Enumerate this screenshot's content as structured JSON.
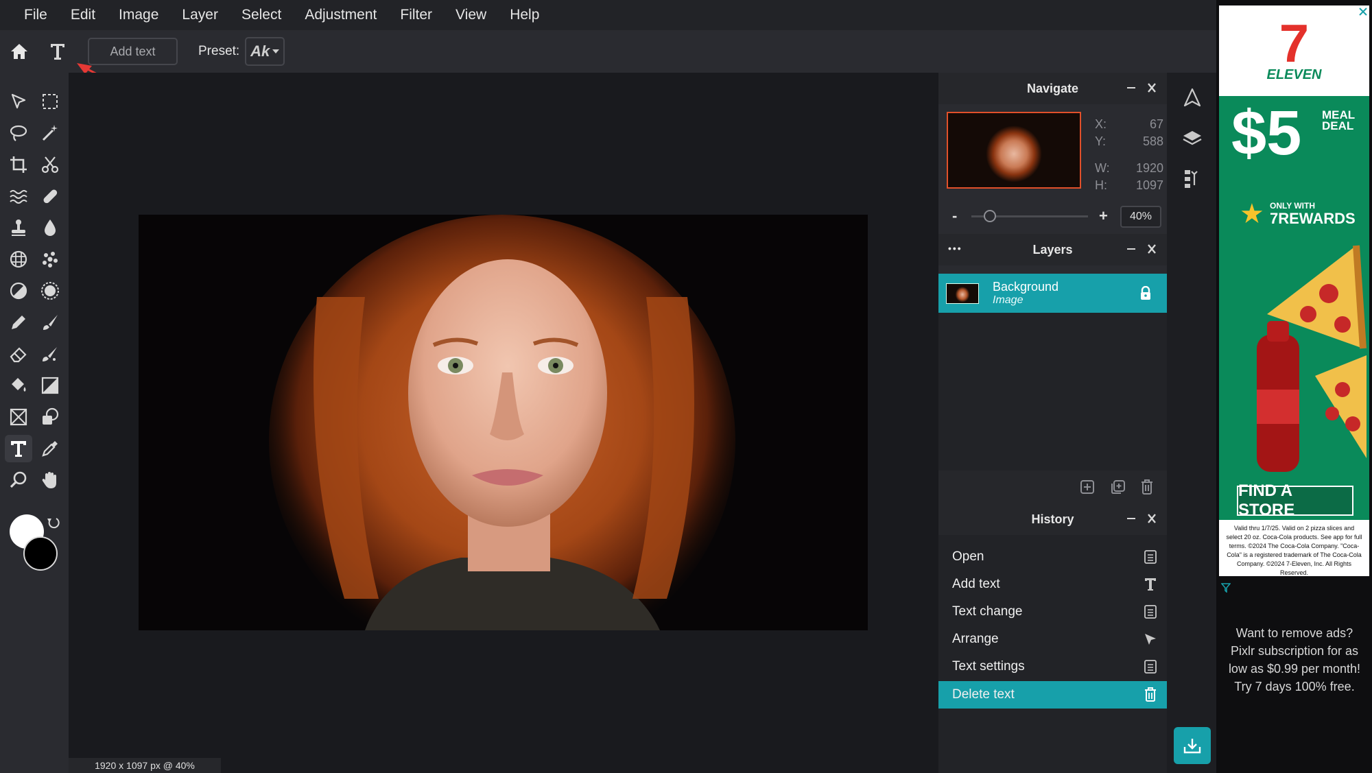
{
  "menu": [
    "File",
    "Edit",
    "Image",
    "Layer",
    "Select",
    "Adjustment",
    "Filter",
    "View",
    "Help"
  ],
  "toolbar": {
    "add_text_label": "Add text",
    "preset_label": "Preset:",
    "preset_value": "Ak"
  },
  "status_bar": "1920 x 1097 px @ 40%",
  "navigate": {
    "title": "Navigate",
    "x_label": "X:",
    "x": "67",
    "y_label": "Y:",
    "y": "588",
    "w_label": "W:",
    "w": "1920",
    "h_label": "H:",
    "h": "1097",
    "zoom_minus": "-",
    "zoom_plus": "+",
    "zoom_value": "40%",
    "zoom_level": 0.08
  },
  "layers": {
    "title": "Layers",
    "menu_dots": "•••",
    "items": [
      {
        "name": "Background",
        "type": "Image"
      }
    ]
  },
  "history": {
    "title": "History",
    "items": [
      "Open",
      "Add text",
      "Text change",
      "Arrange",
      "Text settings",
      "Delete text"
    ],
    "active_index": 5
  },
  "ad": {
    "brand": "ELEVEN",
    "price": "$5",
    "meal_line1": "MEAL",
    "meal_line2": "DEAL",
    "only_with": "ONLY WITH",
    "rewards": "7REWARDS",
    "cta": "FIND A STORE",
    "fine_print": "Valid thru 1/7/25. Valid on 2 pizza slices and select 20 oz. Coca-Cola products. See app for full terms. ©2024 The Coca-Cola Company. \"Coca-Cola\" is a registered trademark of The Coca-Cola Company. ©2024 7-Eleven, Inc. All Rights Reserved.",
    "remove_ads": "Want to remove ads? Pixlr subscription for as low as $0.99 per month! Try 7 days 100% free."
  },
  "colors": {
    "accent": "#17a0aa",
    "menubar": "#222327",
    "panel": "#2a2b30",
    "canvas": "#191a1e",
    "arrow": "#e53935"
  }
}
